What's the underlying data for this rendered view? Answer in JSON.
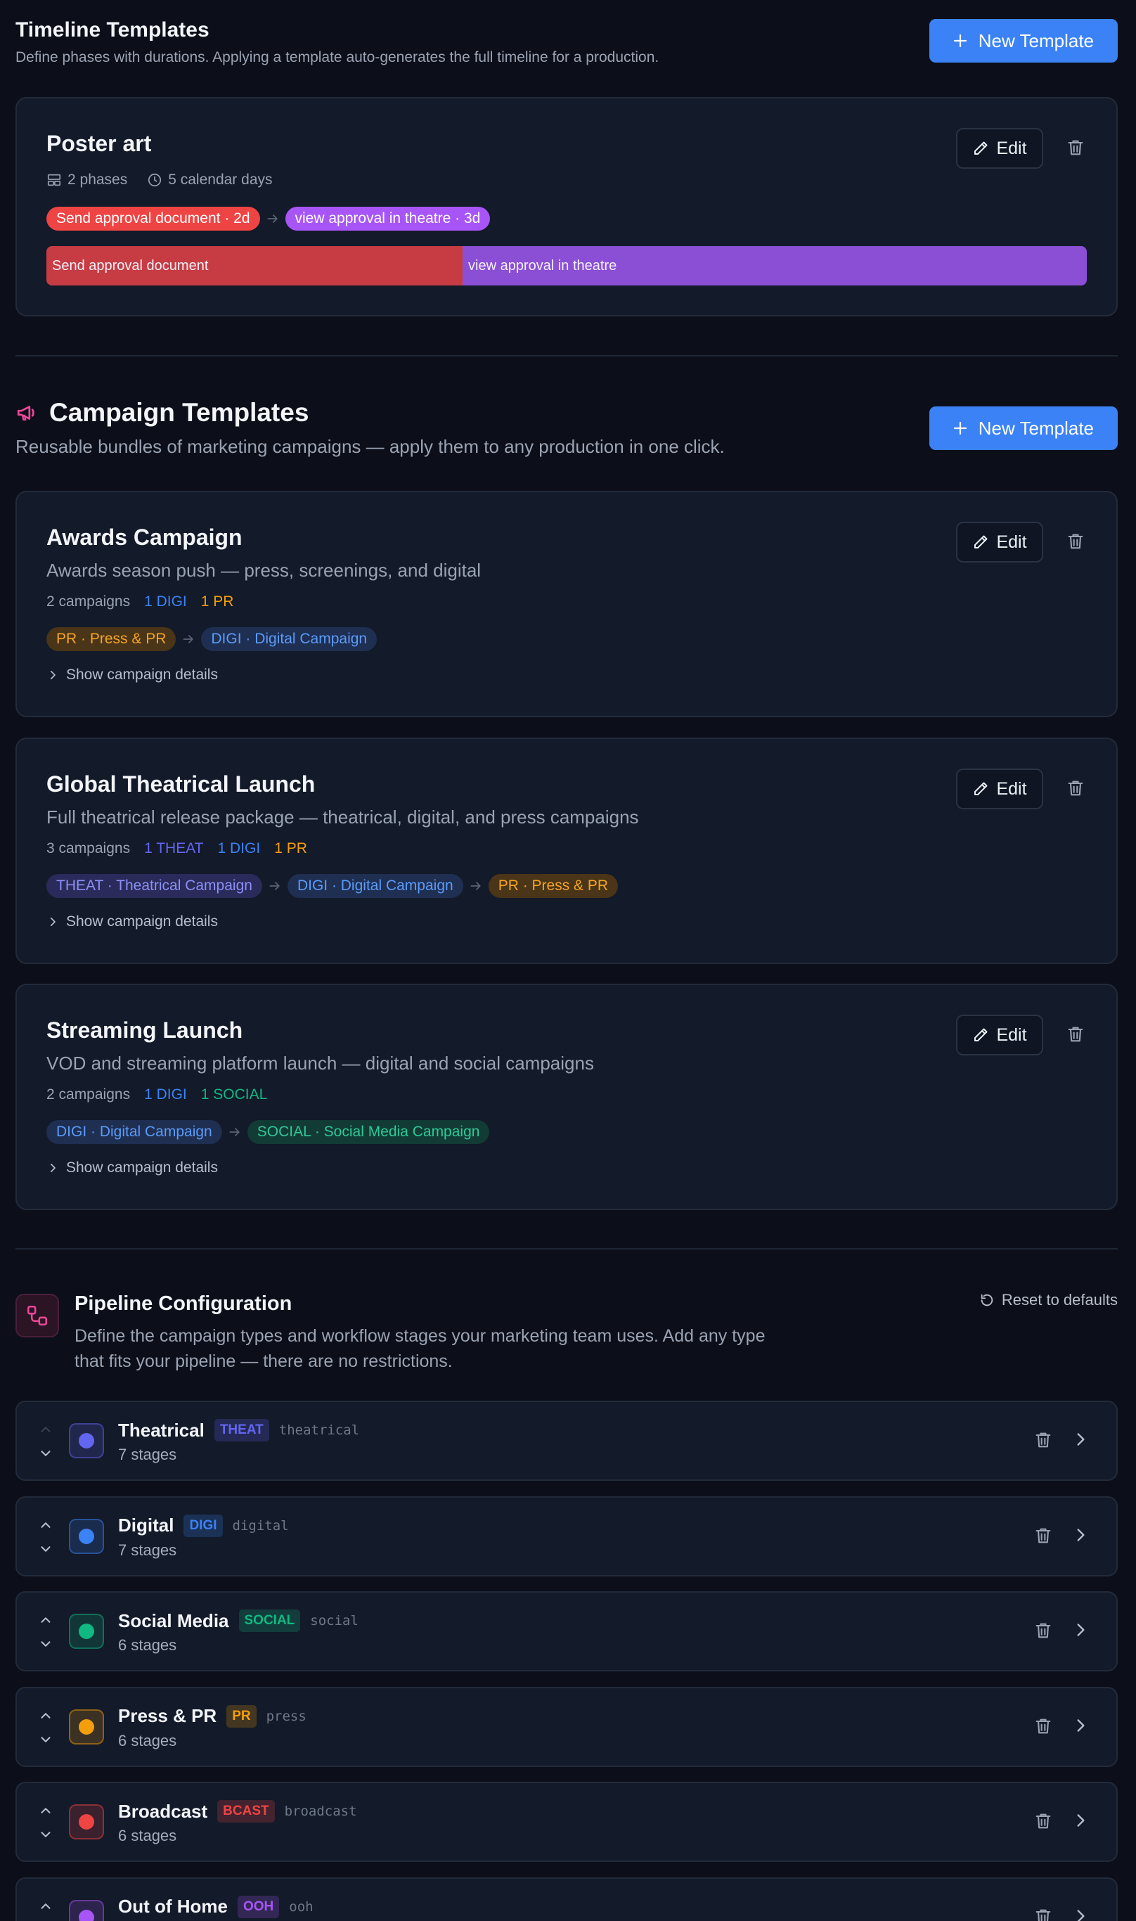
{
  "timeline": {
    "title": "Timeline Templates",
    "subtitle": "Define phases with durations. Applying a template auto-generates the full timeline for a production.",
    "new_button": "New Template",
    "template": {
      "name": "Poster art",
      "phases_count": "2 phases",
      "duration": "5 calendar days",
      "edit_label": "Edit",
      "phases": [
        {
          "chip": "Send approval document · 2d",
          "bar_label": "Send approval document",
          "days": 2,
          "color": "#ef4444",
          "bar_color": "#c73c43"
        },
        {
          "chip": "view approval in theatre · 3d",
          "bar_label": "view approval in theatre",
          "days": 3,
          "color": "#a855f7",
          "bar_color": "#8b4fd6"
        }
      ]
    }
  },
  "campaigns": {
    "title": "Campaign Templates",
    "subtitle": "Reusable bundles of marketing campaigns — apply them to any production in one click.",
    "new_button": "New Template",
    "edit_label": "Edit",
    "show_details": "Show campaign details",
    "templates": [
      {
        "name": "Awards Campaign",
        "description": "Awards season push — press, screenings, and digital",
        "count": "2 campaigns",
        "tags": [
          {
            "text": "1 DIGI",
            "color": "#3b82f6"
          },
          {
            "text": "1 PR",
            "color": "#f59e0b"
          }
        ],
        "chain": [
          {
            "text": "PR · Press & PR",
            "type": "pr"
          },
          {
            "text": "DIGI · Digital Campaign",
            "type": "digi"
          }
        ]
      },
      {
        "name": "Global Theatrical Launch",
        "description": "Full theatrical release package — theatrical, digital, and press campaigns",
        "count": "3 campaigns",
        "tags": [
          {
            "text": "1 THEAT",
            "color": "#6366f1"
          },
          {
            "text": "1 DIGI",
            "color": "#3b82f6"
          },
          {
            "text": "1 PR",
            "color": "#f59e0b"
          }
        ],
        "chain": [
          {
            "text": "THEAT · Theatrical Campaign",
            "type": "theat"
          },
          {
            "text": "DIGI · Digital Campaign",
            "type": "digi"
          },
          {
            "text": "PR · Press & PR",
            "type": "pr"
          }
        ]
      },
      {
        "name": "Streaming Launch",
        "description": "VOD and streaming platform launch — digital and social campaigns",
        "count": "2 campaigns",
        "tags": [
          {
            "text": "1 DIGI",
            "color": "#3b82f6"
          },
          {
            "text": "1 SOCIAL",
            "color": "#10b981"
          }
        ],
        "chain": [
          {
            "text": "DIGI · Digital Campaign",
            "type": "digi"
          },
          {
            "text": "SOCIAL · Social Media Campaign",
            "type": "social"
          }
        ]
      }
    ]
  },
  "pipeline": {
    "title": "Pipeline Configuration",
    "description": "Define the campaign types and workflow stages your marketing team uses. Add any type that fits your pipeline — there are no restrictions.",
    "reset_label": "Reset to defaults",
    "types": [
      {
        "name": "Theatrical",
        "code": "THEAT",
        "slug": "theatrical",
        "stages": "7 stages",
        "color": "#6366f1"
      },
      {
        "name": "Digital",
        "code": "DIGI",
        "slug": "digital",
        "stages": "7 stages",
        "color": "#3b82f6"
      },
      {
        "name": "Social Media",
        "code": "SOCIAL",
        "slug": "social",
        "stages": "6 stages",
        "color": "#10b981"
      },
      {
        "name": "Press & PR",
        "code": "PR",
        "slug": "press",
        "stages": "6 stages",
        "color": "#f59e0b"
      },
      {
        "name": "Broadcast",
        "code": "BCAST",
        "slug": "broadcast",
        "stages": "6 stages",
        "color": "#ef4444"
      },
      {
        "name": "Out of Home",
        "code": "OOH",
        "slug": "ooh",
        "stages": "",
        "color": "#a855f7"
      }
    ]
  },
  "chip_styles": {
    "pr": {
      "bg": "#4a3518",
      "fg": "#f5a524"
    },
    "digi": {
      "bg": "#1f2f52",
      "fg": "#5b9bf8"
    },
    "theat": {
      "bg": "#2a2b5a",
      "fg": "#8b8ff5"
    },
    "social": {
      "bg": "#113b34",
      "fg": "#2fc99a"
    }
  },
  "icons": {
    "plus": "plus-icon",
    "pencil": "pencil-icon",
    "trash": "trash-icon",
    "megaphone": "megaphone-icon",
    "workflow": "workflow-icon",
    "reset": "rotate-ccw-icon",
    "chevron_right": "chevron-right-icon",
    "chevron_up": "chevron-up-icon",
    "chevron_down": "chevron-down-icon",
    "layers": "layers-icon",
    "clock": "clock-icon",
    "arrow": "arrow-right-icon"
  }
}
